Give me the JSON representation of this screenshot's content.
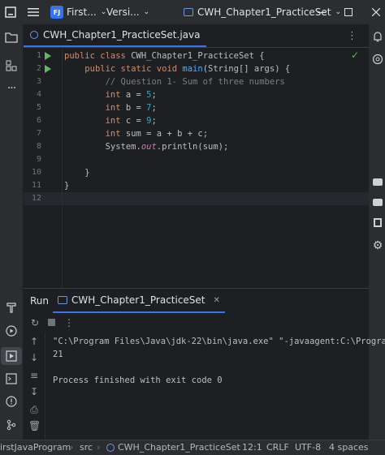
{
  "titlebar": {
    "menu_icon": "hamburger-menu-icon",
    "project_badge": "FJ",
    "project_name": "First...",
    "vcs_label": "Versi...",
    "run_config": "CWH_Chapter1_PracticeSet"
  },
  "editor": {
    "tab_label": "CWH_Chapter1_PracticeSet.java",
    "lines": [
      {
        "n": "1",
        "parts": [
          [
            "kw",
            "public class "
          ],
          [
            "",
            "CWH_Chapter1_PracticeSet {"
          ]
        ],
        "run": true
      },
      {
        "n": "2",
        "parts": [
          [
            "",
            "    "
          ],
          [
            "kw",
            "public static void "
          ],
          [
            "fn",
            "main"
          ],
          [
            "",
            "(String[] args) {"
          ]
        ],
        "run": true
      },
      {
        "n": "3",
        "parts": [
          [
            "",
            "        "
          ],
          [
            "cm",
            "// Question 1- Sum of three numbers"
          ]
        ],
        "run": false
      },
      {
        "n": "4",
        "parts": [
          [
            "",
            "        "
          ],
          [
            "kw",
            "int "
          ],
          [
            "",
            "a = "
          ],
          [
            "num",
            "5"
          ],
          [
            "",
            ";"
          ]
        ],
        "run": false
      },
      {
        "n": "5",
        "parts": [
          [
            "",
            "        "
          ],
          [
            "kw",
            "int "
          ],
          [
            "",
            "b = "
          ],
          [
            "num",
            "7"
          ],
          [
            "",
            ";"
          ]
        ],
        "run": false
      },
      {
        "n": "6",
        "parts": [
          [
            "",
            "        "
          ],
          [
            "kw",
            "int "
          ],
          [
            "",
            "c = "
          ],
          [
            "num",
            "9"
          ],
          [
            "",
            ";"
          ]
        ],
        "run": false
      },
      {
        "n": "7",
        "parts": [
          [
            "",
            "        "
          ],
          [
            "kw",
            "int "
          ],
          [
            "",
            "sum = a + b + c;"
          ]
        ],
        "run": false
      },
      {
        "n": "8",
        "parts": [
          [
            "",
            "        System."
          ],
          [
            "fld",
            "out"
          ],
          [
            "",
            ".println(sum);"
          ]
        ],
        "run": false
      },
      {
        "n": "9",
        "parts": [],
        "run": false
      },
      {
        "n": "10",
        "parts": [
          [
            "",
            "    }"
          ]
        ],
        "run": false
      },
      {
        "n": "11",
        "parts": [
          [
            "",
            "}"
          ]
        ],
        "run": false
      },
      {
        "n": "12",
        "parts": [],
        "run": false
      }
    ]
  },
  "run_panel": {
    "title": "Run",
    "tab_label": "CWH_Chapter1_PracticeSet",
    "console": [
      "\"C:\\Program Files\\Java\\jdk-22\\bin\\java.exe\" \"-javaagent:C:\\Program",
      "21",
      "",
      "Process finished with exit code 0"
    ]
  },
  "statusbar": {
    "project": "irstJavaProgram",
    "src": "src",
    "file": "CWH_Chapter1_PracticeSet",
    "position": "12:1",
    "line_sep": "CRLF",
    "encoding": "UTF-8",
    "indent": "4 spaces"
  }
}
